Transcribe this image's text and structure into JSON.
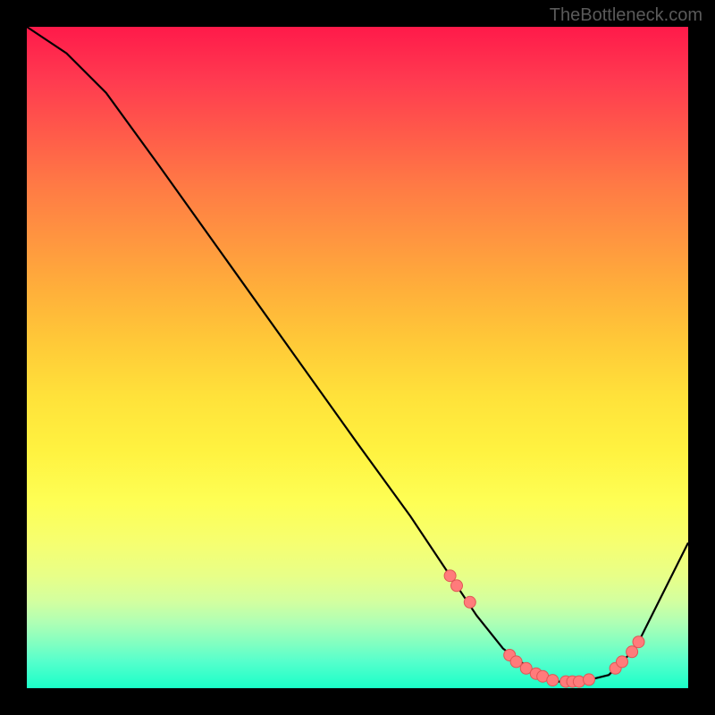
{
  "watermark": "TheBottleneck.com",
  "chart_data": {
    "type": "line",
    "title": "",
    "xlabel": "",
    "ylabel": "",
    "xlim": [
      0,
      100
    ],
    "ylim": [
      0,
      100
    ],
    "series": [
      {
        "name": "curve",
        "x": [
          0,
          6,
          12,
          20,
          30,
          40,
          50,
          58,
          64,
          68,
          72,
          76,
          80,
          84,
          88,
          92,
          100
        ],
        "values": [
          100,
          96,
          90,
          79,
          65,
          51,
          37,
          26,
          17,
          11,
          6,
          3,
          1,
          1,
          2,
          6,
          22
        ]
      }
    ],
    "markers": {
      "name": "dots",
      "x": [
        64,
        65,
        67,
        73,
        74,
        75.5,
        77,
        78,
        79.5,
        81.5,
        82.5,
        83.5,
        85,
        89,
        90,
        91.5,
        92.5
      ],
      "values": [
        17.0,
        15.5,
        13.0,
        5.0,
        4.0,
        3.0,
        2.2,
        1.8,
        1.2,
        1.0,
        1.0,
        1.0,
        1.3,
        3.0,
        4.0,
        5.5,
        7.0
      ]
    },
    "colors": {
      "curve_stroke": "#000000",
      "marker_fill": "#ff7b7b",
      "marker_stroke": "#e05555"
    }
  }
}
